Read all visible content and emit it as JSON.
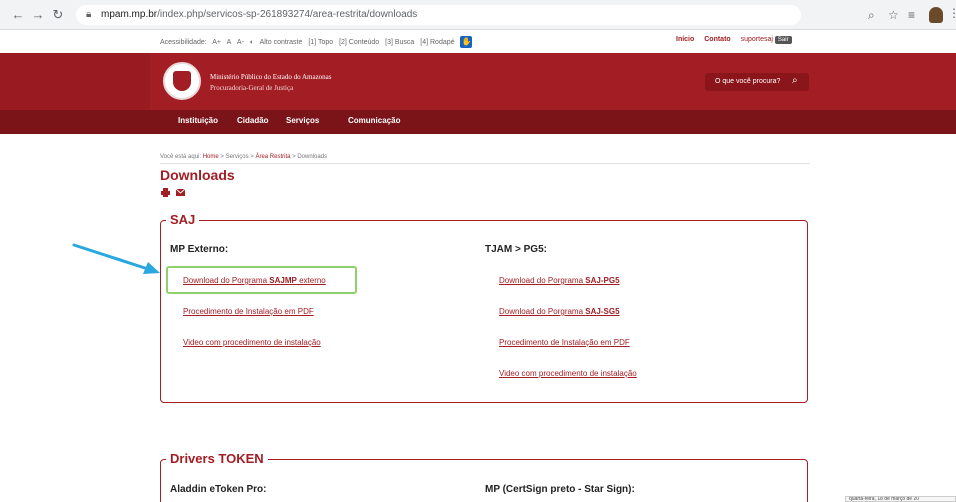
{
  "browser": {
    "url_domain": "mpam.mp.br",
    "url_path": "/index.php/servicos-sp-261893274/area-restrita/downloads",
    "icons": [
      "back-icon",
      "forward-icon",
      "reload-icon",
      "lock-icon",
      "zoom-icon",
      "star-icon",
      "extension-icon",
      "profile-icon",
      "menu-icon"
    ]
  },
  "utility_bar": {
    "items": [
      "Acessibilidade:",
      "A+",
      "A",
      "A-",
      "Alto contraste",
      "[1] Topo",
      "[2] Conteúdo",
      "[3] Busca",
      "[4] Rodapé"
    ],
    "right_links": [
      "Início",
      "Contato"
    ],
    "user": "suportesaj",
    "logout": "Sair"
  },
  "header": {
    "org_line1": "Ministério Público do Estado do Amazonas",
    "org_line2": "Procuradoria-Geral de Justiça",
    "search_placeholder": "O que você procura?"
  },
  "main_nav": [
    "Instituição",
    "Cidadão",
    "Serviços",
    "Comunicação"
  ],
  "breadcrumb": {
    "prefix": "Você está aqui:",
    "items": [
      "Home",
      "Serviços",
      "Área Restrita",
      "Downloads"
    ],
    "separator": ">"
  },
  "page_title": "Downloads",
  "sections": {
    "saj": {
      "legend": "SAJ",
      "left": {
        "heading": "MP Externo:",
        "links": [
          {
            "pre": "Download do Porgrama ",
            "bold": "SAJMP",
            "post": " externo"
          },
          {
            "pre": "Procedimento de Instalação em PDF",
            "bold": "",
            "post": ""
          },
          {
            "pre": "Video com procedimento de instalação",
            "bold": "",
            "post": ""
          }
        ]
      },
      "right": {
        "heading": "TJAM > PG5:",
        "links": [
          {
            "pre": "Download do Porgrama ",
            "bold": "SAJ-PG5",
            "post": ""
          },
          {
            "pre": "Download do Porgrama ",
            "bold": "SAJ-SG5",
            "post": ""
          },
          {
            "pre": "Procedimento de Instalação em PDF",
            "bold": "",
            "post": ""
          },
          {
            "pre": "Video com procedimento de instalação",
            "bold": "",
            "post": ""
          }
        ]
      }
    },
    "drivers": {
      "legend": "Drivers TOKEN",
      "left_heading": "Aladdin eToken Pro:",
      "right_heading": "MP (CertSign preto - Star Sign):"
    }
  },
  "taskbar_tooltip": "quarta-feira, 18 de março de 20",
  "colors": {
    "brand_red": "#a31d24",
    "nav_dark_red": "#7a1419",
    "highlight_green": "#8ed16a",
    "arrow_blue": "#29a8e0"
  }
}
